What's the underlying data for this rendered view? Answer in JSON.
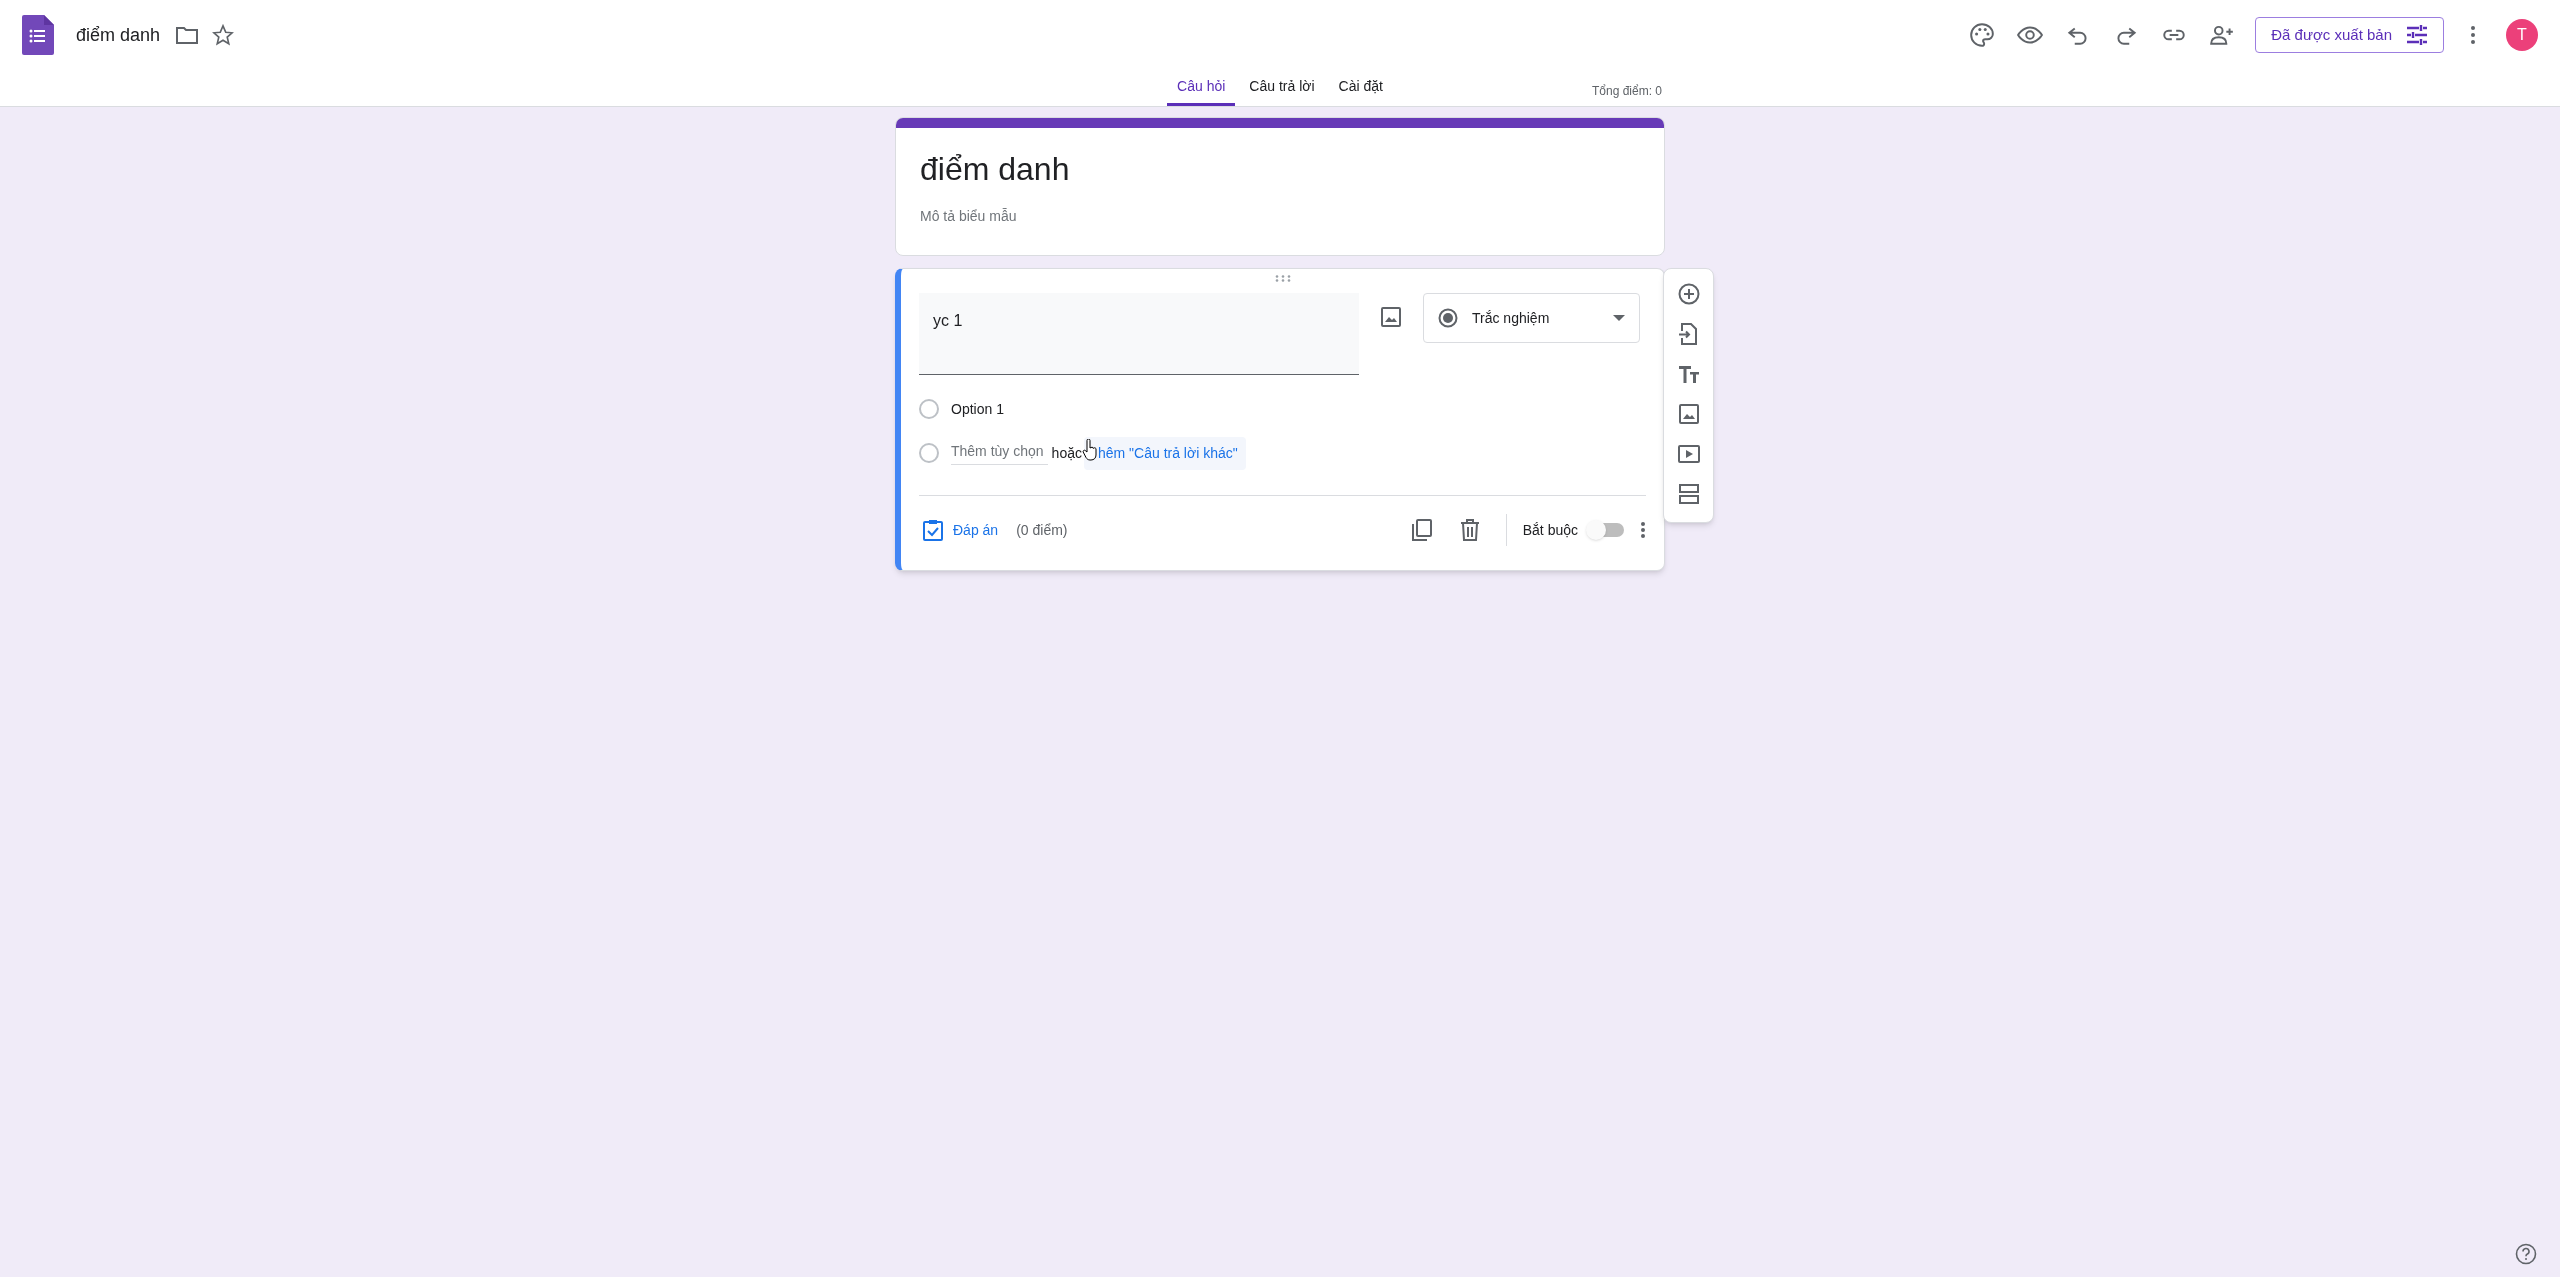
{
  "header": {
    "title": "điểm danh",
    "publish_button": "Đã được xuất bản",
    "avatar_letter": "T"
  },
  "tabs": [
    {
      "label": "Câu hỏi",
      "selected": true
    },
    {
      "label": "Câu trả lời",
      "selected": false
    },
    {
      "label": "Cài đặt",
      "selected": false
    }
  ],
  "total_points": "Tổng điểm: 0",
  "form": {
    "title": "điểm danh",
    "description": "Mô tả biểu mẫu"
  },
  "question": {
    "text": "yc 1",
    "type": "Trắc nghiệm",
    "options": [
      "Option 1"
    ],
    "add_option": "Thêm tùy chọn",
    "or": "hoặc",
    "add_other": "hêm \"Câu trả lời khác\"",
    "answer_key": "Đáp án",
    "points": "(0 điểm)",
    "required_label": "Bắt buộc",
    "required": false
  }
}
